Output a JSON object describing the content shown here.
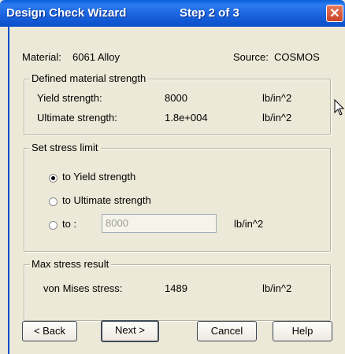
{
  "window": {
    "title": "Design Check Wizard",
    "step": "Step 2 of 3",
    "close_glyph": "✕"
  },
  "material": {
    "label": "Material:",
    "value": "6061 Alloy",
    "source_label": "Source:",
    "source_value": "COSMOS"
  },
  "defined_strength": {
    "legend": "Defined material strength",
    "rows": [
      {
        "label": "Yield strength:",
        "value": "8000",
        "unit": "lb/in^2"
      },
      {
        "label": "Ultimate strength:",
        "value": "1.8e+004",
        "unit": "lb/in^2"
      }
    ]
  },
  "stress_limit": {
    "legend": "Set stress limit",
    "options": [
      {
        "label": "to Yield strength",
        "checked": true
      },
      {
        "label": "to Ultimate strength",
        "checked": false
      },
      {
        "label": "to :",
        "checked": false
      }
    ],
    "custom_value": "8000",
    "custom_unit": "lb/in^2"
  },
  "max_stress": {
    "legend": "Max stress result",
    "label": "von Mises stress:",
    "value": "1489",
    "unit": "lb/in^2"
  },
  "buttons": {
    "back": "< Back",
    "next": "Next >",
    "cancel": "Cancel",
    "help": "Help"
  },
  "colors": {
    "titlebar": "#1b63df",
    "dialog_bg": "#ece9d8"
  }
}
